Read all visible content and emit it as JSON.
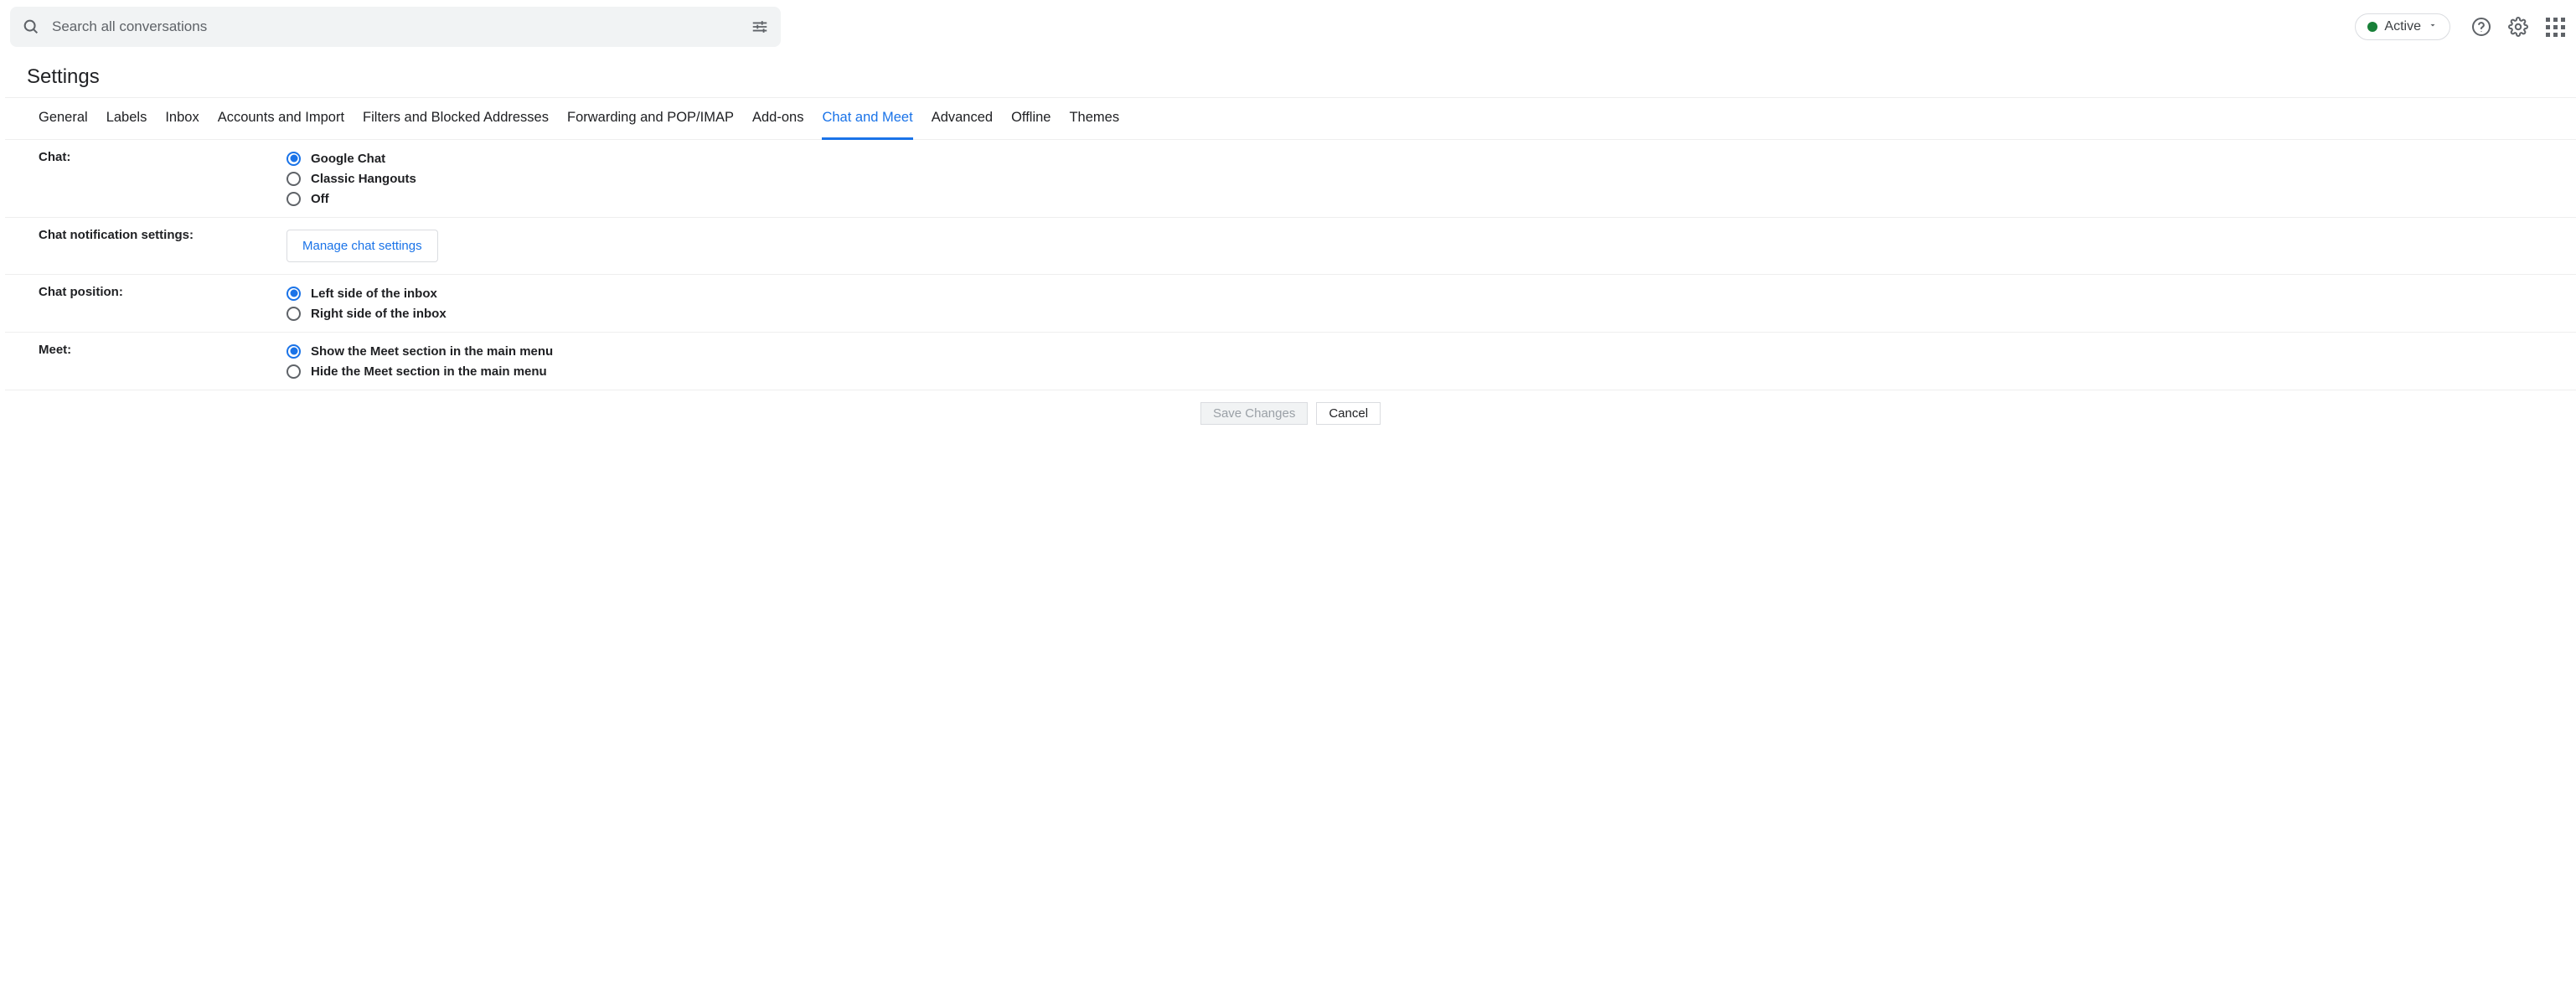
{
  "search": {
    "placeholder": "Search all conversations"
  },
  "status": {
    "label": "Active"
  },
  "page": {
    "title": "Settings"
  },
  "tabs": [
    {
      "label": "General",
      "active": false,
      "id": "general"
    },
    {
      "label": "Labels",
      "active": false,
      "id": "labels"
    },
    {
      "label": "Inbox",
      "active": false,
      "id": "inbox"
    },
    {
      "label": "Accounts and Import",
      "active": false,
      "id": "accounts-and-import"
    },
    {
      "label": "Filters and Blocked Addresses",
      "active": false,
      "id": "filters-and-blocked-addresses"
    },
    {
      "label": "Forwarding and POP/IMAP",
      "active": false,
      "id": "forwarding-and-pop-imap"
    },
    {
      "label": "Add-ons",
      "active": false,
      "id": "add-ons"
    },
    {
      "label": "Chat and Meet",
      "active": true,
      "id": "chat-and-meet"
    },
    {
      "label": "Advanced",
      "active": false,
      "id": "advanced"
    },
    {
      "label": "Offline",
      "active": false,
      "id": "offline"
    },
    {
      "label": "Themes",
      "active": false,
      "id": "themes"
    }
  ],
  "sections": {
    "chat": {
      "label": "Chat:",
      "options": [
        {
          "label": "Google Chat",
          "checked": true
        },
        {
          "label": "Classic Hangouts",
          "checked": false
        },
        {
          "label": "Off",
          "checked": false
        }
      ]
    },
    "chat_notification": {
      "label": "Chat notification settings:",
      "button": "Manage chat settings"
    },
    "chat_position": {
      "label": "Chat position:",
      "options": [
        {
          "label": "Left side of the inbox",
          "checked": true
        },
        {
          "label": "Right side of the inbox",
          "checked": false
        }
      ]
    },
    "meet": {
      "label": "Meet:",
      "options": [
        {
          "label": "Show the Meet section in the main menu",
          "checked": true
        },
        {
          "label": "Hide the Meet section in the main menu",
          "checked": false
        }
      ]
    }
  },
  "buttons": {
    "save": "Save Changes",
    "cancel": "Cancel"
  }
}
